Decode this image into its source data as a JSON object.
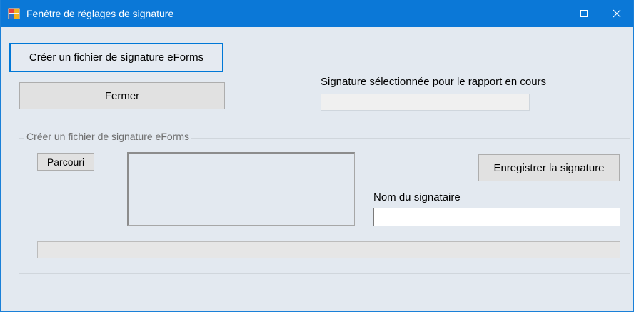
{
  "window": {
    "title": "Fenêtre de réglages de signature",
    "controls": {
      "minimize": "—",
      "maximize": "☐",
      "close": "✕"
    }
  },
  "buttons": {
    "create_file": "Créer un fichier de signature eForms",
    "close": "Fermer",
    "browse": "Parcouri",
    "save_signature": "Enregistrer la signature"
  },
  "selected_signature": {
    "label": "Signature sélectionnée pour le rapport en cours",
    "value": ""
  },
  "group": {
    "title": "Créer un fichier de signature eForms"
  },
  "signer": {
    "label": "Nom du signataire",
    "value": ""
  },
  "progress": {
    "value": 0
  },
  "colors": {
    "titlebar": "#0b78d7",
    "window_bg": "#e3e9f0",
    "accent": "#0078d7"
  }
}
